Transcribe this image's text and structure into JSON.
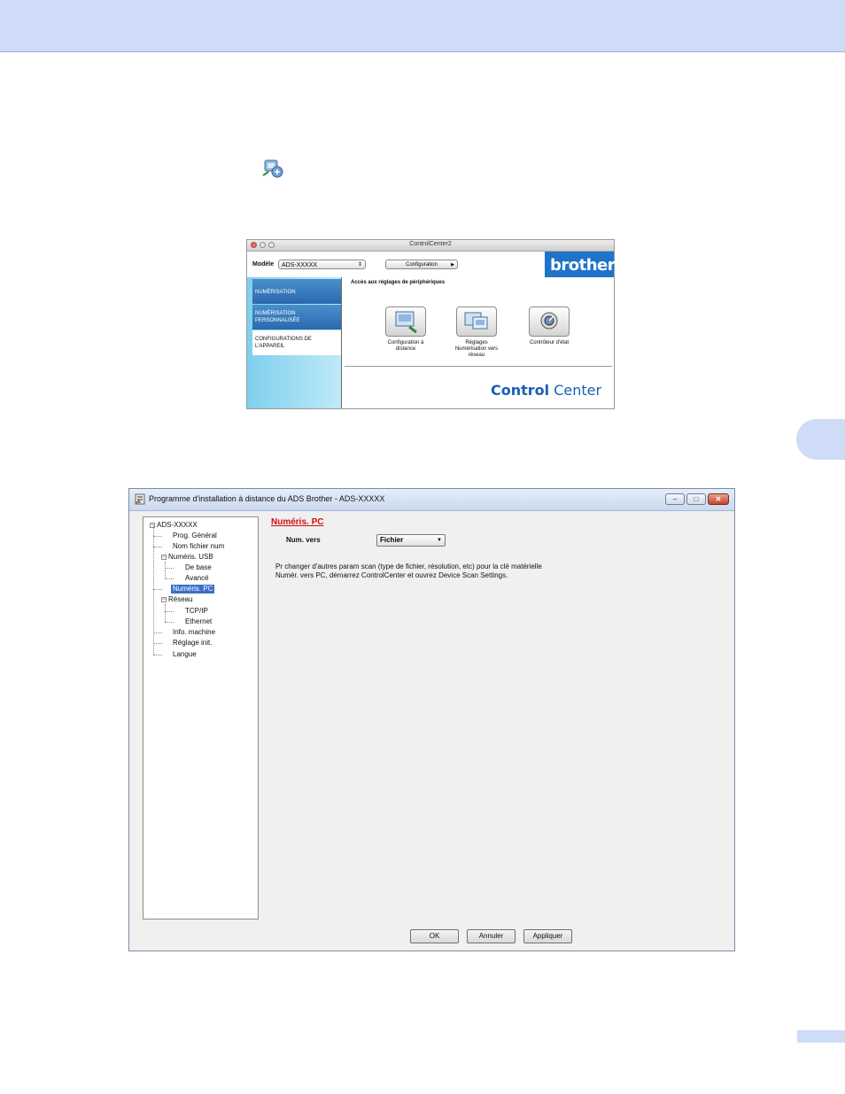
{
  "controlcenter": {
    "window_title": "ControlCenter2",
    "model_label": "Modèle",
    "model_value": "ADS-XXXXX",
    "config_button": "Configuration",
    "brand": "brother",
    "nav": [
      {
        "line1": "NUMÉRISATION",
        "line2": ""
      },
      {
        "line1": "NUMÉRISATION",
        "line2": "PERSONNALISÉE"
      },
      {
        "line1": "CONFIGURATIONS DE",
        "line2": "L'APPAREIL"
      }
    ],
    "section_heading": "Accès aux réglages de périphériques",
    "tools": [
      {
        "line1": "Configuration à",
        "line2": "distance",
        "line3": "",
        "icon": "remote-setup-icon"
      },
      {
        "line1": "Réglages",
        "line2": "Numérisation vers",
        "line3": "réseau",
        "icon": "scan-to-network-icon"
      },
      {
        "line1": "Contrôleur d'état",
        "line2": "",
        "line3": "",
        "icon": "status-monitor-icon"
      }
    ],
    "logo_bold": "Control",
    "logo_regular": " Center"
  },
  "remote_setup": {
    "title": "Programme d'installation à distance du ADS Brother - ADS-XXXXX",
    "tree": {
      "root": "ADS-XXXXX",
      "prog_general": "Prog. Général",
      "nom_fichier": "Nom fichier num",
      "numeris_usb": "Numéris. USB",
      "de_base": "De base",
      "avance": "Avancé",
      "numeris_pc": "Numéris. PC",
      "reseau": "Réseau",
      "tcpip": "TCP/IP",
      "ethernet": "Ethernet",
      "info_machine": "Info. machine",
      "reglage_init": "Réglage init.",
      "langue": "Langue"
    },
    "section_title": "Numéris. PC",
    "field_label": "Num. vers",
    "field_value": "Fichier",
    "info_line1": "Pr changer d'autres param scan (type de fichier, résolution, etc) pour la clé matérielle",
    "info_line2": "Numér. vers PC, démarrez ControlCenter et ouvrez Device Scan Settings.",
    "buttons": {
      "ok": "OK",
      "cancel": "Annuler",
      "apply": "Appliquer"
    }
  },
  "colors": {
    "header_band": "#cfdcf7",
    "section_title": "#d01010",
    "brand_blue": "#1f74c9",
    "tree_selection": "#3b6fc9"
  }
}
